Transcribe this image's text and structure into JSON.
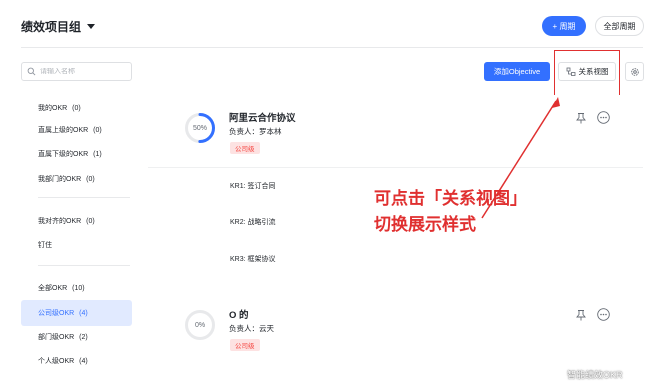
{
  "header": {
    "group_title": "绩效项目组",
    "cycle_button": "+ 周期",
    "all_cycles_button": "全部周期"
  },
  "toolbar": {
    "search_placeholder": "请输入名称",
    "add_objective": "添加Objective",
    "relation_view": "关系视图"
  },
  "sidebar": {
    "items": [
      {
        "label": "我的OKR",
        "count": "(0)"
      },
      {
        "label": "直属上级的OKR",
        "count": "(0)"
      },
      {
        "label": "直属下级的OKR",
        "count": "(1)"
      },
      {
        "label": "我部门的OKR",
        "count": "(0)"
      },
      {
        "label": "我对齐的OKR",
        "count": "(0)"
      },
      {
        "label": "钉住",
        "count": ""
      },
      {
        "label": "全部OKR",
        "count": "(10)"
      },
      {
        "label": "公司级OKR",
        "count": "(4)"
      },
      {
        "label": "部门级OKR",
        "count": "(2)"
      },
      {
        "label": "个人级OKR",
        "count": "(4)"
      }
    ],
    "active_index": 7
  },
  "objectives": [
    {
      "progress": "50%",
      "progress_value": 0.5,
      "title": "阿里云合作协议",
      "owner_label": "负责人：",
      "owner": "罗本林",
      "tag": "公司级",
      "key_results": [
        "KR1:  签订合同",
        "KR2:  战略引流",
        "KR3:  框架协议"
      ]
    },
    {
      "progress": "0%",
      "progress_value": 0,
      "title": "O 的",
      "owner_label": "负责人：",
      "owner": "云天",
      "tag": "公司级"
    }
  ],
  "annotation": {
    "line1": "可点击「关系视图」",
    "line2": "切换展示样式"
  },
  "watermark": "智能绩效OKR",
  "colors": {
    "accent": "#3370ff",
    "annotation_red": "#e03030",
    "tag_bg": "#fde2e2",
    "tag_text": "#f54a45",
    "active_bg": "#e1eaff"
  }
}
